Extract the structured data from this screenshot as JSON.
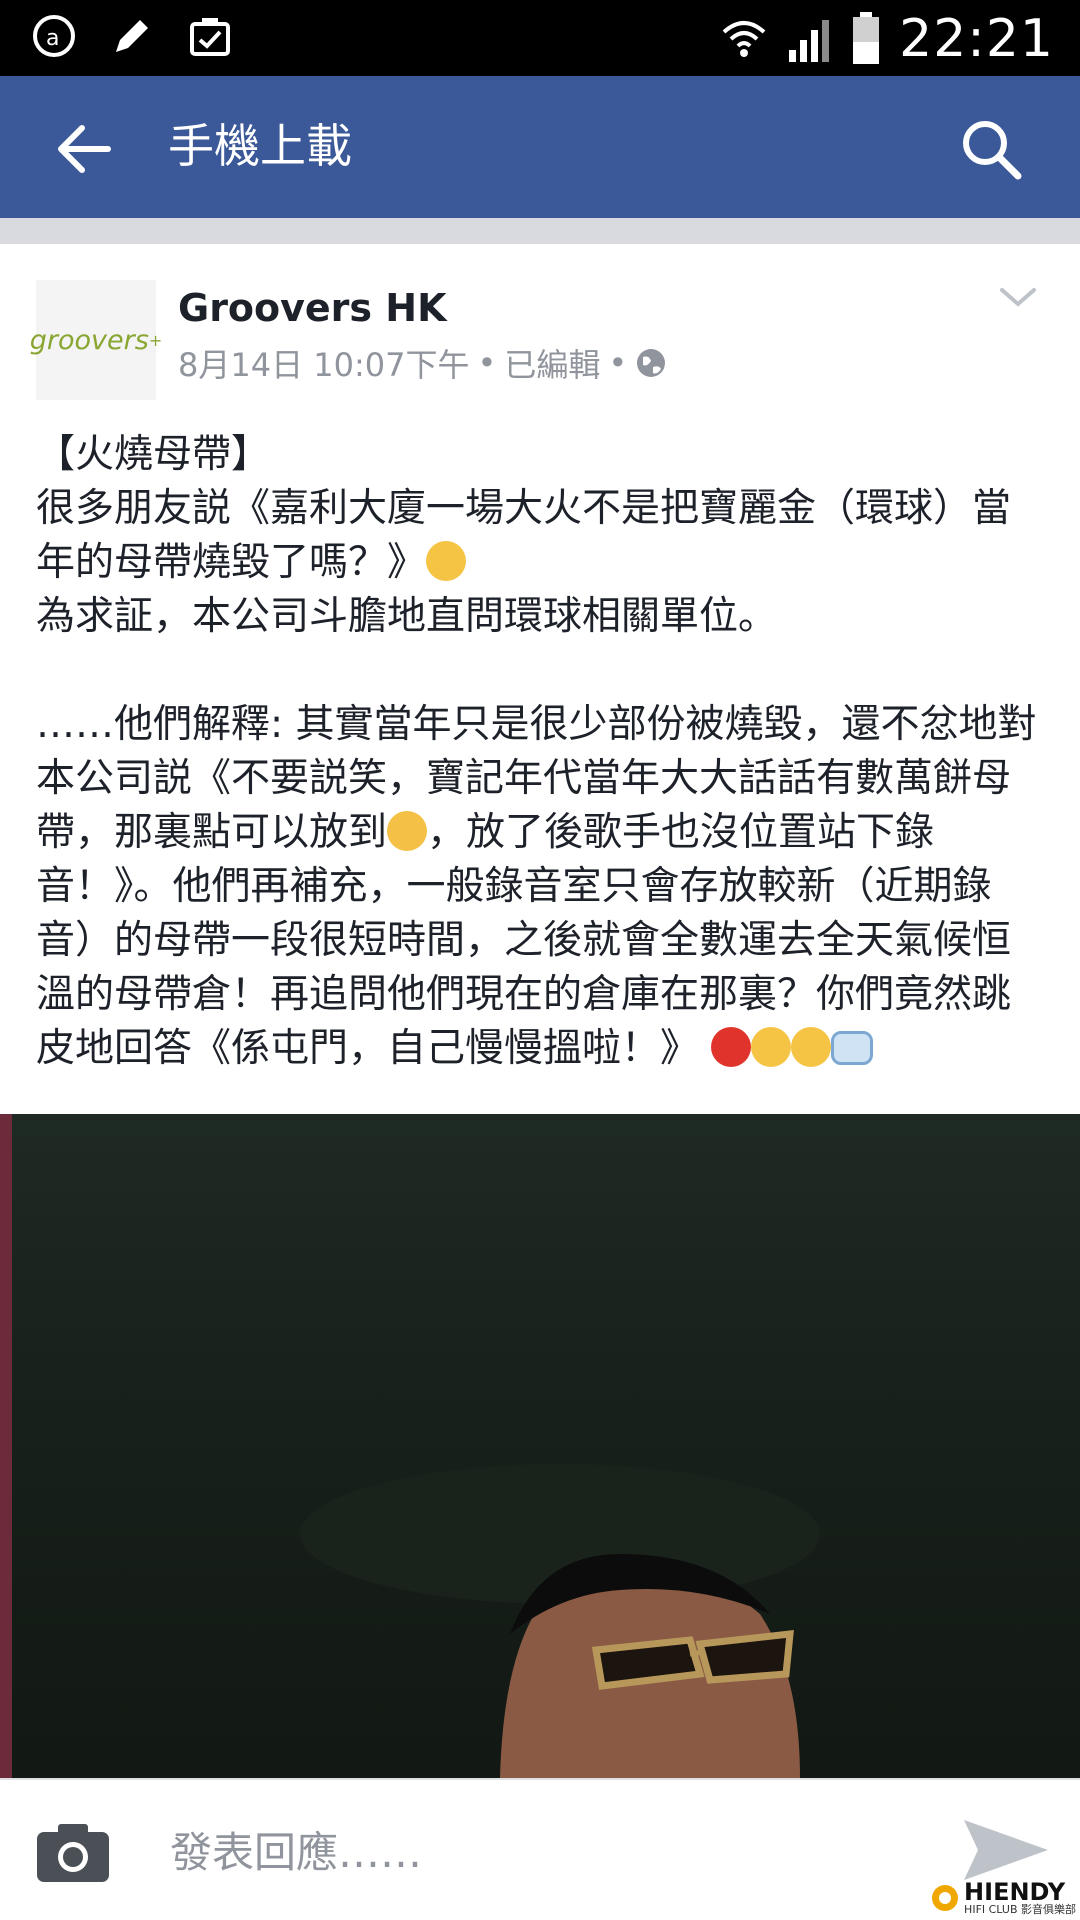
{
  "status_bar": {
    "time": "22:21",
    "icons": [
      "notification-app-icon",
      "pencil-icon",
      "clipboard-check-icon",
      "wifi-icon",
      "cellular-signal-icon",
      "battery-icon"
    ]
  },
  "app_bar": {
    "title": "手機上載",
    "back_icon": "arrow-left-icon",
    "search_icon": "search-icon",
    "color": "#3b5998"
  },
  "post": {
    "avatar_text": "groovers",
    "avatar_plus": "+",
    "page_name": "Groovers HK",
    "meta": {
      "date": "8月14日 10:07下午",
      "separator": "•",
      "edited": "已編輯",
      "privacy_icon": "globe-icon"
    },
    "body": {
      "line1": "【火燒母帶】",
      "line2a": "很多朋友説《嘉利大廈一場大火不是把寶麗金（環球）當年的母帶燒毀了嗎？》",
      "line3": "為求証，本公司斗膽地直問環球相關單位。",
      "line4a": "……他們解釋: 其實當年只是很少部份被燒毀，還不忿地對本公司説《不要説笑，寶記年代當年大大話話有數萬餅母帶，那裏點可以放到",
      "line4b": "，放了後歌手也沒位置站下錄音！》。他們再補充，一般錄音室只會存放較新（近期錄音）的母帶一段很短時間，之後就會全數運去全天氣候恒溫的母帶倉！再追問他們現在的倉庫在那裏？你們竟然跳皮地回答《係屯門，自己慢慢搵啦！》"
    }
  },
  "comment_bar": {
    "placeholder": "發表回應……",
    "camera_icon": "camera-icon",
    "send_icon": "send-icon"
  },
  "watermark": {
    "brand": "HIENDY",
    "sub": "HIFI CLUB 影音俱樂部"
  }
}
